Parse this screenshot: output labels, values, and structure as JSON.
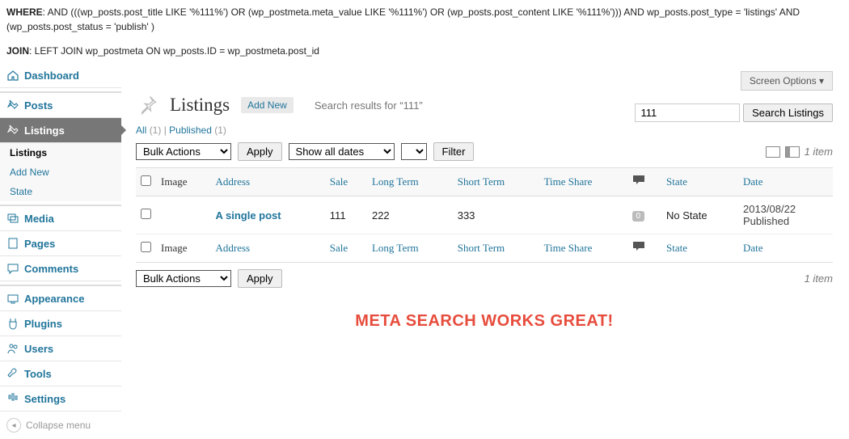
{
  "debug": {
    "where_label": "WHERE",
    "where_text": ": AND (((wp_posts.post_title LIKE '%111%') OR (wp_postmeta.meta_value LIKE '%111%') OR (wp_posts.post_content LIKE '%111%'))) AND wp_posts.post_type = 'listings' AND (wp_posts.post_status = 'publish' )",
    "join_label": "JOIN",
    "join_text": ": LEFT JOIN wp_postmeta ON wp_posts.ID = wp_postmeta.post_id"
  },
  "sidebar": {
    "items": [
      {
        "icon": "home",
        "label": "Dashboard"
      },
      {
        "icon": "pin",
        "label": "Posts"
      },
      {
        "icon": "pin",
        "label": "Listings",
        "current": true
      },
      {
        "icon": "media",
        "label": "Media"
      },
      {
        "icon": "page",
        "label": "Pages"
      },
      {
        "icon": "comment",
        "label": "Comments"
      },
      {
        "icon": "appearance",
        "label": "Appearance"
      },
      {
        "icon": "plugin",
        "label": "Plugins"
      },
      {
        "icon": "user",
        "label": "Users"
      },
      {
        "icon": "tool",
        "label": "Tools"
      },
      {
        "icon": "settings",
        "label": "Settings"
      }
    ],
    "submenu": [
      {
        "label": "Listings",
        "current": true
      },
      {
        "label": "Add New"
      },
      {
        "label": "State"
      }
    ],
    "collapse": "Collapse menu"
  },
  "screen_options": "Screen Options ▾",
  "header": {
    "title": "Listings",
    "add_new": "Add New",
    "search_prefix": "Search results for ",
    "search_term": "“111”"
  },
  "subsubsub": {
    "all": "All",
    "all_count": "(1)",
    "sep": " | ",
    "published": "Published",
    "published_count": "(1)"
  },
  "search": {
    "value": "111",
    "button": "Search Listings"
  },
  "tablenav": {
    "bulk": "Bulk Actions",
    "apply": "Apply",
    "dates": "Show all dates",
    "filter": "Filter",
    "count": "1 item"
  },
  "columns": {
    "image": "Image",
    "address": "Address",
    "sale": "Sale",
    "long": "Long Term",
    "short": "Short Term",
    "time": "Time Share",
    "state": "State",
    "date": "Date"
  },
  "rows": [
    {
      "title": "A single post",
      "sale": "111",
      "long": "222",
      "short": "333",
      "time": "",
      "comments": "0",
      "state": "No State",
      "date": "2013/08/22",
      "status": "Published"
    }
  ],
  "banner": "META SEARCH WORKS GREAT!"
}
